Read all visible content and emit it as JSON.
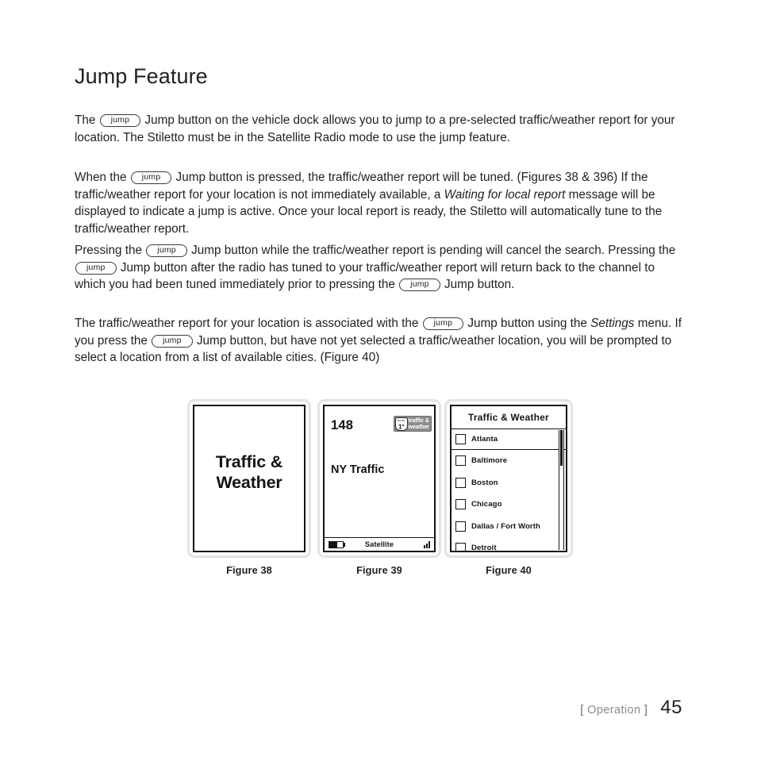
{
  "heading": "Jump Feature",
  "jump_button_label": "jump",
  "paragraphs": {
    "p1": {
      "seg1": "The ",
      "seg2": " Jump button on the vehicle dock allows you to jump to a pre-selected traffic/weather report for your location. The Stiletto must be in the Satellite Radio mode to use the jump feature."
    },
    "p2": {
      "seg1": "When the ",
      "seg2": " Jump button is pressed, the traffic/weather report will be tuned. (Figures 38 & 396) If the traffic/weather report for your location is not immediately available, a ",
      "em1": "Waiting for local report",
      "seg3": " message will be displayed to indicate a jump is active. Once your local report is ready, the Stiletto will automatically tune to the traffic/weather report."
    },
    "p3": {
      "seg1": "Pressing the ",
      "seg2": " Jump button while the traffic/weather report is pending will cancel the search. Pressing the ",
      "seg3": " Jump button after the radio has tuned to your traffic/weather report will return back to the channel to which you had been tuned immediately prior to pressing the ",
      "seg4": " Jump button."
    },
    "p4": {
      "seg1": "The traffic/weather report for your location is associated with the ",
      "seg2": " Jump button using the ",
      "em1": "Settings",
      "seg3": " menu. If you press the ",
      "seg4": " Jump button, but have not yet selected a traffic/weather location, you will be prompted to select a location from a list of available cities. (Figure 40)"
    }
  },
  "figures": [
    {
      "id": "figure-38",
      "caption": "Figure 38",
      "screen": {
        "type": "splash",
        "line1": "Traffic &",
        "line2": "Weather"
      }
    },
    {
      "id": "figure-39",
      "caption": "Figure 39",
      "screen": {
        "type": "now-playing",
        "channel_number": "148",
        "program_title": "NY Traffic",
        "logo": {
          "shield_top": "ROUTE",
          "shield_number": "1",
          "shield_number_sup": "st",
          "line1": "traffic &",
          "line2": "weather"
        },
        "status": {
          "source": "Satellite"
        }
      }
    },
    {
      "id": "figure-40",
      "caption": "Figure 40",
      "screen": {
        "type": "city-list",
        "header": "Traffic & Weather",
        "cities": [
          "Atlanta",
          "Baltimore",
          "Boston",
          "Chicago",
          "Dallas / Fort Worth",
          "Detroit"
        ]
      }
    }
  ],
  "footer": {
    "bracket_open": "[",
    "section": "Operation",
    "bracket_close": "]",
    "page_number": "45"
  }
}
